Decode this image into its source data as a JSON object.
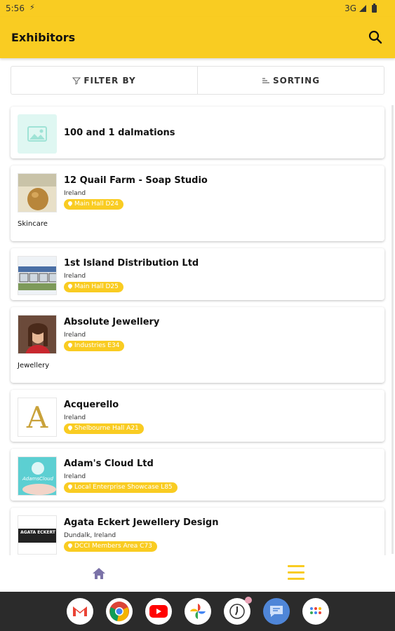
{
  "status_bar": {
    "time": "5:56",
    "network": "3G"
  },
  "app_bar": {
    "title": "Exhibitors"
  },
  "filters": {
    "filter_label": "FILTER BY",
    "sort_label": "SORTING"
  },
  "exhibitors": [
    {
      "name": "100 and 1 dalmations",
      "location": "",
      "stand": "",
      "category": ""
    },
    {
      "name": "12 Quail Farm - Soap Studio",
      "location": "Ireland",
      "stand": "Main Hall D24",
      "category": "Skincare"
    },
    {
      "name": "1st Island Distribution Ltd",
      "location": "Ireland",
      "stand": "Main Hall D25",
      "category": ""
    },
    {
      "name": "Absolute Jewellery",
      "location": "Ireland",
      "stand": "Industries E34",
      "category": "Jewellery"
    },
    {
      "name": "Acquerello",
      "location": "Ireland",
      "stand": "Shelbourne Hall A21",
      "category": ""
    },
    {
      "name": "Adam's Cloud Ltd",
      "location": "Ireland",
      "stand": "Local Enterprise Showcase L85",
      "category": ""
    },
    {
      "name": "Agata Eckert Jewellery Design",
      "location": "Dundalk, Ireland",
      "stand": "DCCI Members Area C73",
      "category": ""
    }
  ],
  "logos": {
    "acquerello_letter": "A",
    "adams_cloud_logo": "AdamsCloud",
    "agata_logo": "AGATA ECKERT"
  },
  "colors": {
    "accent": "#f9cc22",
    "nav_home": "#7b72a8"
  },
  "dock_apps": [
    "gmail-icon",
    "chrome-icon",
    "youtube-icon",
    "photos-icon",
    "clock-icon",
    "messages-icon",
    "app-drawer-icon"
  ]
}
